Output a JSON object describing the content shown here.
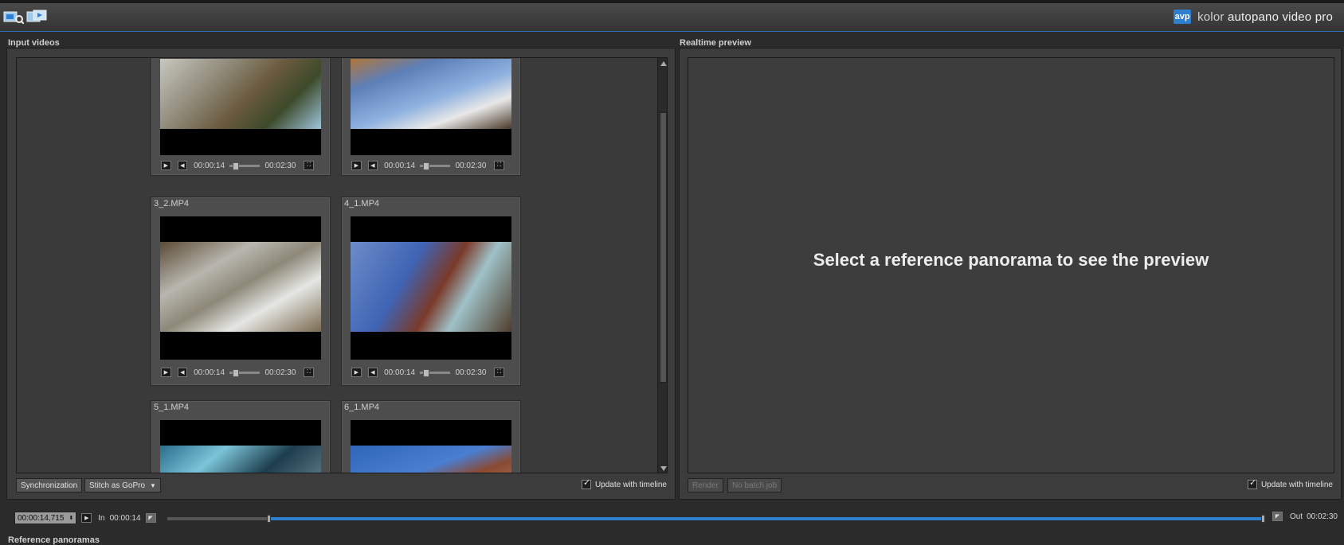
{
  "app": {
    "logo_badge": "avp",
    "brand_prefix": "kolor ",
    "brand_name": "autopano video pro",
    "accent_color": "#2f7fd0"
  },
  "toolbar": {
    "icons": [
      "import-videos-icon",
      "detect-icon"
    ]
  },
  "input_videos": {
    "title": "Input videos",
    "cards": [
      {
        "name": "",
        "current_time": "00:00:14",
        "duration": "00:02:30"
      },
      {
        "name": "",
        "current_time": "00:00:14",
        "duration": "00:02:30"
      },
      {
        "name": "3_2.MP4",
        "current_time": "00:00:14",
        "duration": "00:02:30"
      },
      {
        "name": "4_1.MP4",
        "current_time": "00:00:14",
        "duration": "00:02:30"
      },
      {
        "name": "5_1.MP4",
        "current_time": "",
        "duration": ""
      },
      {
        "name": "6_1.MP4",
        "current_time": "",
        "duration": ""
      }
    ],
    "buttons": {
      "synchronization": "Synchronization",
      "stitch": "Stitch  as GoPro"
    },
    "update_with_timeline": "Update with timeline"
  },
  "preview": {
    "title": "Realtime preview",
    "message": "Select a reference panorama to see the preview",
    "render": "Render",
    "batch": "No batch job",
    "update_with_timeline": "Update with timeline"
  },
  "timeline": {
    "current": "00:00:14,715",
    "in_label": "In",
    "in_time": "00:00:14",
    "out_label": "Out",
    "out_time": "00:02:30",
    "progress_start_fraction": 0.093,
    "progress_color": "#2f7fd0"
  },
  "reference": {
    "title": "Reference panoramas"
  }
}
